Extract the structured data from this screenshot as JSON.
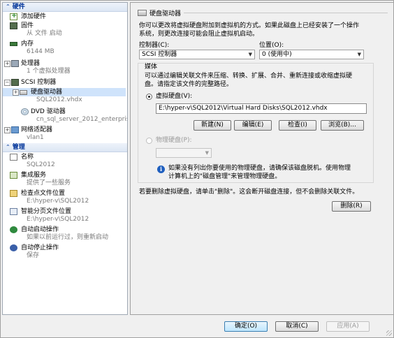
{
  "tree": {
    "hardware_header": "硬件",
    "management_header": "管理",
    "hardware": [
      {
        "label": "添加硬件"
      },
      {
        "label": "固件",
        "sub": "从 文件 启动"
      },
      {
        "label": "内存",
        "sub": "6144 MB"
      },
      {
        "label": "处理器",
        "sub": "1 个虚拟处理器"
      },
      {
        "label": "SCSI 控制器"
      },
      {
        "label": "硬盘驱动器",
        "sub": "SQL2012.vhdx"
      },
      {
        "label": "DVD 驱动器",
        "sub": "cn_sql_server_2012_enterpris..."
      },
      {
        "label": "网络适配器",
        "sub": "vlan1"
      }
    ],
    "management": [
      {
        "label": "名称",
        "sub": "SQL2012"
      },
      {
        "label": "集成服务",
        "sub": "提供了一些服务"
      },
      {
        "label": "检查点文件位置",
        "sub": "E:\\hyper-v\\SQL2012"
      },
      {
        "label": "智能分页文件位置",
        "sub": "E:\\hyper-v\\SQL2012"
      },
      {
        "label": "自动启动操作",
        "sub": "如果以前运行过，则重新启动"
      },
      {
        "label": "自动停止操作",
        "sub": "保存"
      }
    ]
  },
  "panel": {
    "title": "硬盘驱动器",
    "desc_line1": "你可以更改将虚拟硬盘附加到虚拟机的方式。如果此磁盘上已经安装了一个操作",
    "desc_line2": "系统，则更改连接可能会阻止虚拟机启动。",
    "controller_label": "控制器(C):",
    "controller_value": "SCSI 控制器",
    "location_label": "位置(O):",
    "location_value": "0 (使用中)",
    "media_label": "媒体",
    "media_desc1": "可以通过编辑关联文件来压缩、转换、扩展、合并、重新连接或收缩虚拟硬",
    "media_desc2": "盘。请指定该文件的完整路径。",
    "vhd_radio": "虚拟硬盘(V):",
    "vhd_path": "E:\\hyper-v\\SQL2012\\Virtual Hard Disks\\SQL2012.vhdx",
    "btn_new": "新建(N)",
    "btn_edit": "编辑(E)",
    "btn_inspect": "检查(I)",
    "btn_browse": "浏览(B)...",
    "physical_radio": "物理硬盘(P):",
    "info1": "如果没有列出你要使用的物理硬盘，请确保该磁盘脱机。使用物理",
    "info2": "计算机上的\"磁盘管理\"来管理物理硬盘。",
    "remove_desc": "若要删除虚拟硬盘，请单击\"删除\"。这会断开磁盘连接，但不会删除关联文件。",
    "btn_remove": "删除(R)"
  },
  "footer": {
    "ok": "确定(O)",
    "cancel": "取消(C)",
    "apply": "应用(A)"
  }
}
